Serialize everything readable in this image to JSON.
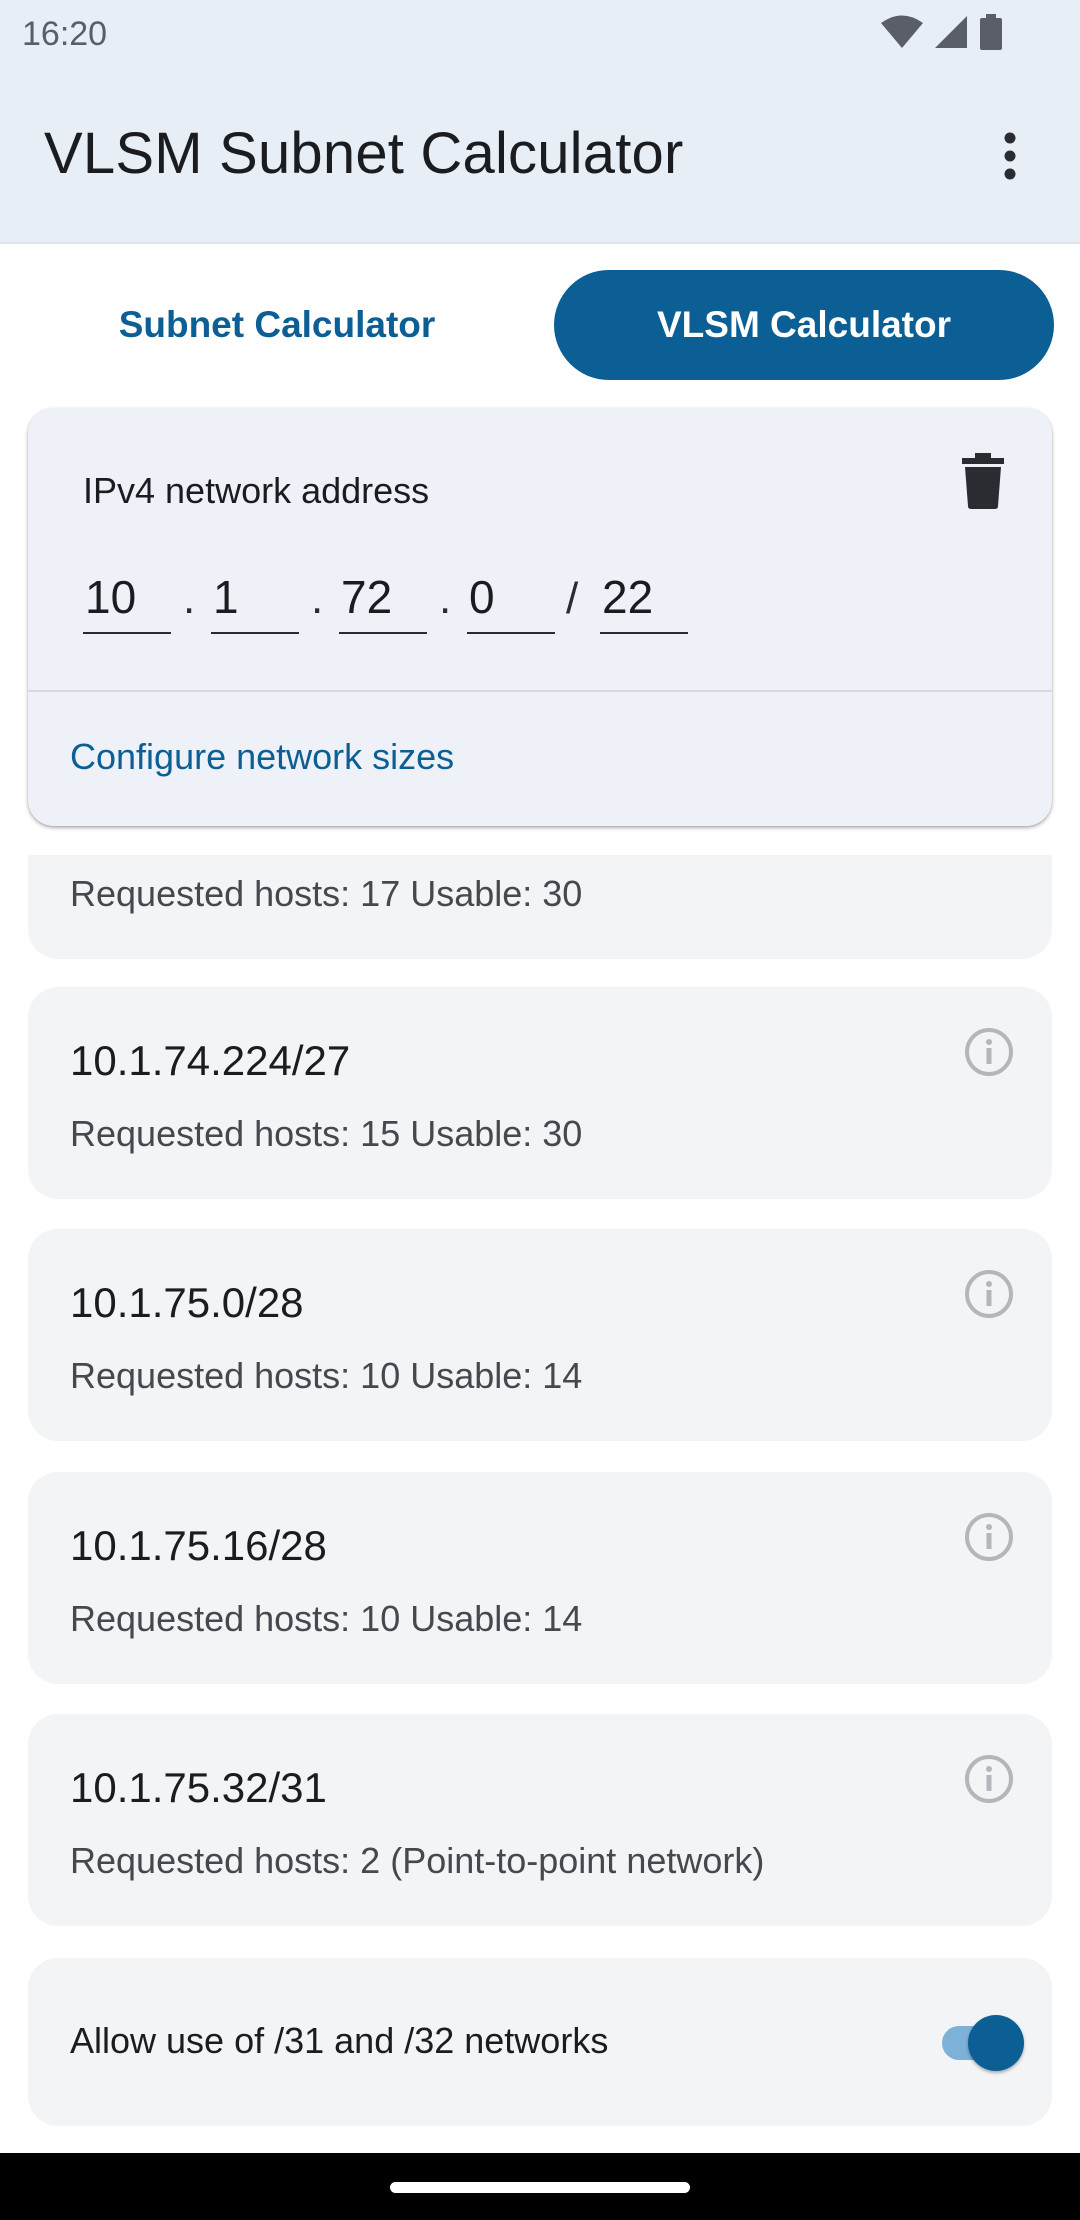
{
  "status_bar": {
    "time": "16:20",
    "icons": [
      "wifi-icon",
      "cellular-signal-icon",
      "battery-icon"
    ]
  },
  "app_bar": {
    "title": "VLSM Subnet Calculator",
    "menu_icon": "more-vert-icon"
  },
  "tabs": [
    {
      "label": "Subnet Calculator",
      "selected": false
    },
    {
      "label": "VLSM Calculator",
      "selected": true
    }
  ],
  "network": {
    "label": "IPv4 network address",
    "octets": [
      "10",
      "1",
      "72",
      "0"
    ],
    "prefix": "22",
    "dot": ".",
    "slash": "/",
    "delete_icon": "trash-icon",
    "configure_label": "Configure network sizes"
  },
  "results": [
    {
      "title": "",
      "subtitle": "Requested hosts: 17 Usable: 30"
    },
    {
      "title": "10.1.74.224/27",
      "subtitle": "Requested hosts: 15 Usable: 30"
    },
    {
      "title": "10.1.75.0/28",
      "subtitle": "Requested hosts: 10 Usable: 14"
    },
    {
      "title": "10.1.75.16/28",
      "subtitle": "Requested hosts: 10 Usable: 14"
    },
    {
      "title": "10.1.75.32/31",
      "subtitle": "Requested hosts: 2 (Point-to-point network)"
    }
  ],
  "toggle": {
    "label": "Allow use of /31 and /32 networks",
    "enabled": true
  },
  "colors": {
    "primary": "#0b5f95",
    "app_bar_bg": "#e8eef5",
    "card_bg": "#f3f4f6",
    "network_card_bg": "#eef2f8"
  }
}
